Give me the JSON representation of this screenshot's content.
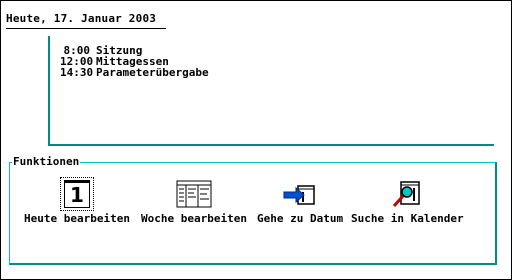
{
  "header": {
    "date_text": "Heute, 17. Januar 2003"
  },
  "schedule": {
    "items": [
      {
        "time": "8:00",
        "title": "Sitzung"
      },
      {
        "time": "12:00",
        "title": "Mittagessen"
      },
      {
        "time": "14:30",
        "title": "Parameterübergabe"
      }
    ]
  },
  "functions": {
    "title": "Funktionen",
    "items": [
      {
        "label": "Heute bearbeiten",
        "icon": "calendar-day-icon",
        "icon_text": "1"
      },
      {
        "label": "Woche bearbeiten",
        "icon": "calendar-week-icon"
      },
      {
        "label": "Gehe zu Datum",
        "icon": "goto-date-icon"
      },
      {
        "label": "Suche in Kalender",
        "icon": "search-calendar-icon"
      }
    ]
  },
  "colors": {
    "accent": "#008b8b",
    "accent_light": "#00c0c0",
    "goto_blue": "#0050d0"
  }
}
